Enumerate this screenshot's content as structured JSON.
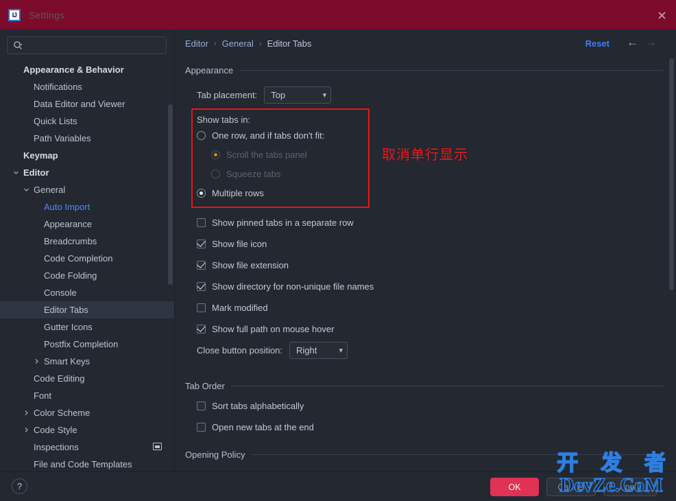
{
  "window": {
    "title": "Settings",
    "app_icon_text": "IJ",
    "close_icon": "close-icon"
  },
  "search": {
    "value": "",
    "placeholder": "",
    "icon": "search-icon"
  },
  "sidebar": {
    "items": [
      {
        "label": "Appearance & Behavior",
        "indent": 0,
        "bold": true,
        "arrow": "none",
        "selected": false,
        "accent": false,
        "badge": false
      },
      {
        "label": "Notifications",
        "indent": 1,
        "bold": false,
        "arrow": "none",
        "selected": false,
        "accent": false,
        "badge": false
      },
      {
        "label": "Data Editor and Viewer",
        "indent": 1,
        "bold": false,
        "arrow": "none",
        "selected": false,
        "accent": false,
        "badge": false
      },
      {
        "label": "Quick Lists",
        "indent": 1,
        "bold": false,
        "arrow": "none",
        "selected": false,
        "accent": false,
        "badge": false
      },
      {
        "label": "Path Variables",
        "indent": 1,
        "bold": false,
        "arrow": "none",
        "selected": false,
        "accent": false,
        "badge": false
      },
      {
        "label": "Keymap",
        "indent": 0,
        "bold": true,
        "arrow": "none",
        "selected": false,
        "accent": false,
        "badge": false
      },
      {
        "label": "Editor",
        "indent": 0,
        "bold": true,
        "arrow": "down",
        "selected": false,
        "accent": false,
        "badge": false
      },
      {
        "label": "General",
        "indent": 1,
        "bold": false,
        "arrow": "down",
        "selected": false,
        "accent": false,
        "badge": false
      },
      {
        "label": "Auto Import",
        "indent": 2,
        "bold": false,
        "arrow": "none",
        "selected": false,
        "accent": true,
        "badge": false
      },
      {
        "label": "Appearance",
        "indent": 2,
        "bold": false,
        "arrow": "none",
        "selected": false,
        "accent": false,
        "badge": false
      },
      {
        "label": "Breadcrumbs",
        "indent": 2,
        "bold": false,
        "arrow": "none",
        "selected": false,
        "accent": false,
        "badge": false
      },
      {
        "label": "Code Completion",
        "indent": 2,
        "bold": false,
        "arrow": "none",
        "selected": false,
        "accent": false,
        "badge": false
      },
      {
        "label": "Code Folding",
        "indent": 2,
        "bold": false,
        "arrow": "none",
        "selected": false,
        "accent": false,
        "badge": false
      },
      {
        "label": "Console",
        "indent": 2,
        "bold": false,
        "arrow": "none",
        "selected": false,
        "accent": false,
        "badge": false
      },
      {
        "label": "Editor Tabs",
        "indent": 2,
        "bold": false,
        "arrow": "none",
        "selected": true,
        "accent": false,
        "badge": false
      },
      {
        "label": "Gutter Icons",
        "indent": 2,
        "bold": false,
        "arrow": "none",
        "selected": false,
        "accent": false,
        "badge": false
      },
      {
        "label": "Postfix Completion",
        "indent": 2,
        "bold": false,
        "arrow": "none",
        "selected": false,
        "accent": false,
        "badge": false
      },
      {
        "label": "Smart Keys",
        "indent": 2,
        "bold": false,
        "arrow": "right",
        "selected": false,
        "accent": false,
        "badge": false
      },
      {
        "label": "Code Editing",
        "indent": 1,
        "bold": false,
        "arrow": "none",
        "selected": false,
        "accent": false,
        "badge": false
      },
      {
        "label": "Font",
        "indent": 1,
        "bold": false,
        "arrow": "none",
        "selected": false,
        "accent": false,
        "badge": false
      },
      {
        "label": "Color Scheme",
        "indent": 1,
        "bold": false,
        "arrow": "right",
        "selected": false,
        "accent": false,
        "badge": false
      },
      {
        "label": "Code Style",
        "indent": 1,
        "bold": false,
        "arrow": "right",
        "selected": false,
        "accent": false,
        "badge": false
      },
      {
        "label": "Inspections",
        "indent": 1,
        "bold": false,
        "arrow": "none",
        "selected": false,
        "accent": false,
        "badge": true
      },
      {
        "label": "File and Code Templates",
        "indent": 1,
        "bold": false,
        "arrow": "none",
        "selected": false,
        "accent": false,
        "badge": false
      }
    ]
  },
  "header": {
    "breadcrumb": [
      "Editor",
      "General",
      "Editor Tabs"
    ],
    "separator": "›",
    "reset_label": "Reset",
    "back_icon": "arrow-left-icon",
    "forward_icon": "arrow-right-icon"
  },
  "appearance_section": {
    "title": "Appearance",
    "tab_placement": {
      "label": "Tab placement:",
      "value": "Top"
    },
    "show_tabs_in": {
      "label": "Show tabs in:",
      "options": [
        {
          "label": "One row, and if tabs don't fit:",
          "checked": false,
          "disabled": false,
          "indent": 0
        },
        {
          "label": "Scroll the tabs panel",
          "checked": true,
          "disabled": true,
          "indent": 1
        },
        {
          "label": "Squeeze tabs",
          "checked": false,
          "disabled": true,
          "indent": 1
        },
        {
          "label": "Multiple rows",
          "checked": true,
          "disabled": false,
          "indent": 0
        }
      ]
    },
    "checkboxes": [
      {
        "label": "Show pinned tabs in a separate row",
        "checked": false
      },
      {
        "label": "Show file icon",
        "checked": true
      },
      {
        "label": "Show file extension",
        "checked": true
      },
      {
        "label": "Show directory for non-unique file names",
        "checked": true
      },
      {
        "label": "Mark modified",
        "checked": false
      },
      {
        "label": "Show full path on mouse hover",
        "checked": true
      }
    ],
    "close_button_position": {
      "label": "Close button position:",
      "value": "Right"
    }
  },
  "tab_order_section": {
    "title": "Tab Order",
    "checkboxes": [
      {
        "label": "Sort tabs alphabetically",
        "checked": false
      },
      {
        "label": "Open new tabs at the end",
        "checked": false
      }
    ]
  },
  "opening_policy_section": {
    "title": "Opening Policy"
  },
  "annotation": {
    "text": "取消单行显示",
    "color": "#f31616"
  },
  "footer": {
    "help_label": "?",
    "ok_label": "OK",
    "cancel_label": "Cancel",
    "apply_label": "Apply",
    "ok_color": "#e23254"
  },
  "watermark": {
    "line1": "开 发 者",
    "line2": "DevZe.CoM",
    "color": "#2f7fe0"
  }
}
